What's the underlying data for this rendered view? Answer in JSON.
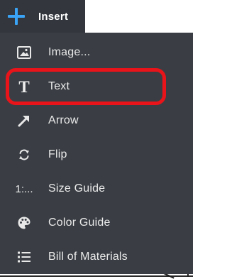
{
  "header": {
    "icon": "plus-icon",
    "title": "Insert",
    "accent_color": "#3aa3f5"
  },
  "menu": {
    "items": [
      {
        "label": "Image...",
        "icon": "image-icon"
      },
      {
        "label": "Text",
        "icon": "text-icon",
        "highlighted": true
      },
      {
        "label": "Arrow",
        "icon": "arrow-icon"
      },
      {
        "label": "Flip",
        "icon": "flip-icon"
      },
      {
        "label": "Size Guide",
        "icon": "size-guide-icon",
        "icon_text": "1:..."
      },
      {
        "label": "Color Guide",
        "icon": "palette-icon"
      },
      {
        "label": "Bill of Materials",
        "icon": "list-icon"
      }
    ],
    "highlight_color": "#e8141a"
  }
}
